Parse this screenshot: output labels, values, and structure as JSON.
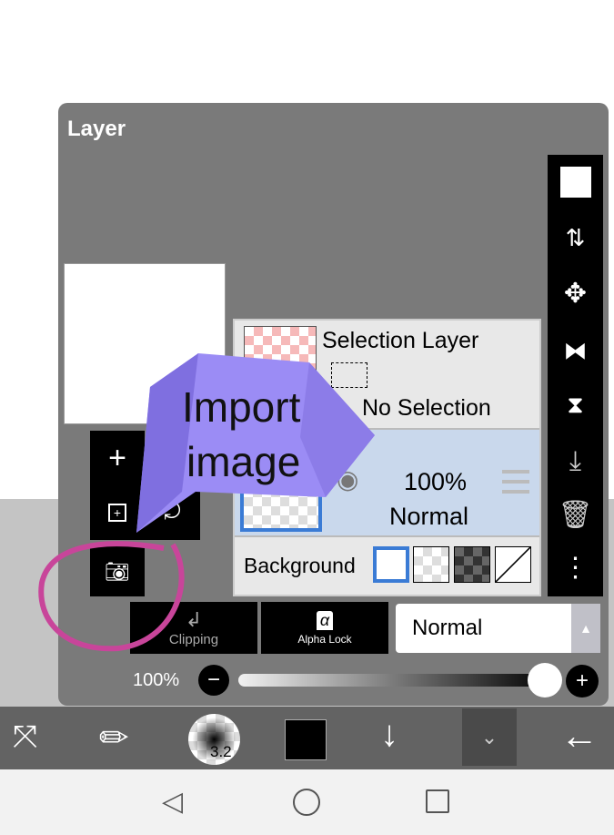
{
  "panel": {
    "title": "Layer"
  },
  "layers": {
    "selection": {
      "name": "Selection Layer",
      "status": "No Selection"
    },
    "layer1": {
      "opacity": "100%",
      "blend": "Normal"
    },
    "background_label": "Background"
  },
  "controls": {
    "clipping": "Clipping",
    "alpha_lock": "Alpha Lock",
    "alpha_glyph": "α",
    "blend_mode": "Normal",
    "opacity": "100%",
    "opacity_value": 100
  },
  "toolbar": {
    "brush_size": "3.2"
  },
  "callout": {
    "line1": "Import",
    "line2": "image"
  },
  "colors": {
    "callout": "#9b8cf5",
    "circle": "#c8459a",
    "selected_layer": "#c9d8ec",
    "accent": "#3a7bd5"
  }
}
